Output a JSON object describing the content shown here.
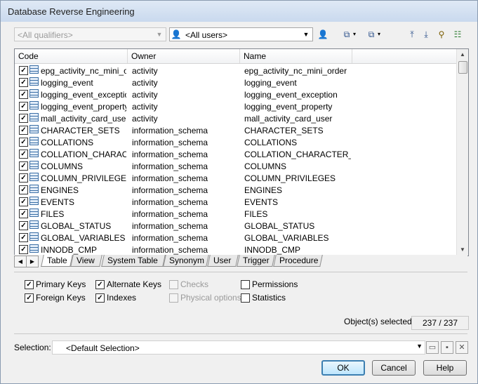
{
  "window": {
    "title": "Database Reverse Engineering"
  },
  "toolbar": {
    "qualifier": {
      "value": "<All qualifiers>"
    },
    "users": {
      "value": "<All users>"
    }
  },
  "table": {
    "columns": [
      "Code",
      "Owner",
      "Name"
    ],
    "rows": [
      {
        "checked": true,
        "code": "epg_activity_nc_mini_o...",
        "owner": "activity",
        "name": "epg_activity_nc_mini_order"
      },
      {
        "checked": true,
        "code": "logging_event",
        "owner": "activity",
        "name": "logging_event"
      },
      {
        "checked": true,
        "code": "logging_event_exception",
        "owner": "activity",
        "name": "logging_event_exception"
      },
      {
        "checked": true,
        "code": "logging_event_property",
        "owner": "activity",
        "name": "logging_event_property"
      },
      {
        "checked": true,
        "code": "mall_activity_card_user",
        "owner": "activity",
        "name": "mall_activity_card_user"
      },
      {
        "checked": true,
        "code": "CHARACTER_SETS",
        "owner": "information_schema",
        "name": "CHARACTER_SETS"
      },
      {
        "checked": true,
        "code": "COLLATIONS",
        "owner": "information_schema",
        "name": "COLLATIONS"
      },
      {
        "checked": true,
        "code": "COLLATION_CHARAC...",
        "owner": "information_schema",
        "name": "COLLATION_CHARACTER_..."
      },
      {
        "checked": true,
        "code": "COLUMNS",
        "owner": "information_schema",
        "name": "COLUMNS"
      },
      {
        "checked": true,
        "code": "COLUMN_PRIVILEGES",
        "owner": "information_schema",
        "name": "COLUMN_PRIVILEGES"
      },
      {
        "checked": true,
        "code": "ENGINES",
        "owner": "information_schema",
        "name": "ENGINES"
      },
      {
        "checked": true,
        "code": "EVENTS",
        "owner": "information_schema",
        "name": "EVENTS"
      },
      {
        "checked": true,
        "code": "FILES",
        "owner": "information_schema",
        "name": "FILES"
      },
      {
        "checked": true,
        "code": "GLOBAL_STATUS",
        "owner": "information_schema",
        "name": "GLOBAL_STATUS"
      },
      {
        "checked": true,
        "code": "GLOBAL_VARIABLES",
        "owner": "information_schema",
        "name": "GLOBAL_VARIABLES"
      },
      {
        "checked": true,
        "code": "INNODB_CMP",
        "owner": "information_schema",
        "name": "INNODB_CMP"
      }
    ]
  },
  "tabs": [
    "Table",
    "View",
    "System Table",
    "Synonym",
    "User",
    "Trigger",
    "Procedure"
  ],
  "options": {
    "primary_keys": {
      "label": "Primary Keys",
      "checked": true
    },
    "foreign_keys": {
      "label": "Foreign Keys",
      "checked": true
    },
    "alternate_keys": {
      "label": "Alternate Keys",
      "checked": true
    },
    "indexes": {
      "label": "Indexes",
      "checked": true
    },
    "checks": {
      "label": "Checks",
      "checked": false
    },
    "physical_options": {
      "label": "Physical options",
      "checked": false
    },
    "permissions": {
      "label": "Permissions",
      "checked": false
    },
    "statistics": {
      "label": "Statistics",
      "checked": false
    }
  },
  "status": {
    "label": "Object(s) selected:",
    "count": "237 / 237"
  },
  "selection": {
    "label": "Selection:",
    "value": "<Default Selection>"
  },
  "buttons": {
    "ok": "OK",
    "cancel": "Cancel",
    "help": "Help"
  },
  "icons": {
    "users_combo": "user-icon",
    "owner_filter": "owner-filter-icon",
    "select_all": "select-all-icon",
    "deselect_all": "deselect-all-icon",
    "move_top": "move-top-icon",
    "move_bottom": "move-bottom-icon",
    "filter": "filter-icon",
    "clear_filter": "clear-filter-icon",
    "open_selection": "open-folder-icon",
    "save_selection": "save-icon",
    "delete_selection": "delete-icon"
  },
  "colors": {
    "accent": "#3c7fb1",
    "table_icon": "#3a6ea5"
  }
}
